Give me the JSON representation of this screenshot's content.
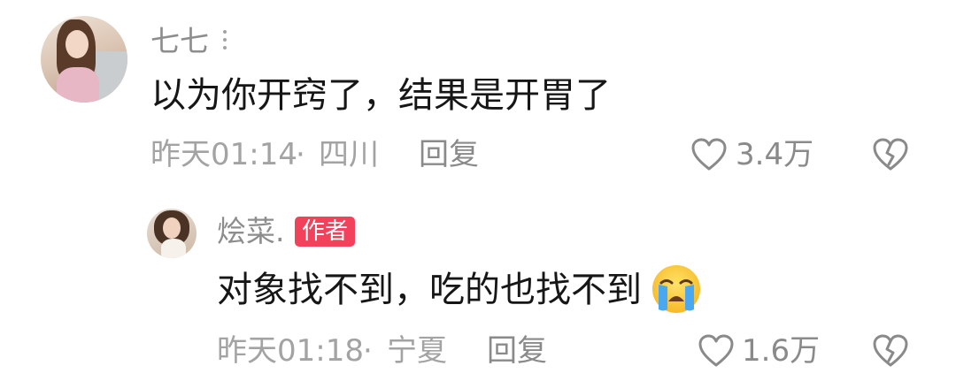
{
  "comments": [
    {
      "username": "七七",
      "text": "以为你开窍了，结果是开胃了",
      "time": "昨天01:14",
      "separator": "·",
      "location": "四川",
      "reply_label": "回复",
      "likes": "3.4万",
      "avatar": "avatar-photo-woman"
    }
  ],
  "replies": [
    {
      "username": "烩菜.",
      "badge": "作者",
      "text": "对象找不到，吃的也找不到",
      "emoji": "loudly-crying-face",
      "time": "昨天01:18",
      "separator": "·",
      "location": "宁夏",
      "reply_label": "回复",
      "likes": "1.6万",
      "avatar": "avatar-photo-woman-with-cat"
    }
  ],
  "icons": {
    "like": "heart-outline-icon",
    "dislike": "broken-heart-icon",
    "more": "more-vertical-icon"
  },
  "colors": {
    "author_badge": "#f2415b",
    "meta_text": "#a3a3a3",
    "username": "#8d8d8d",
    "body_text": "#161616"
  }
}
